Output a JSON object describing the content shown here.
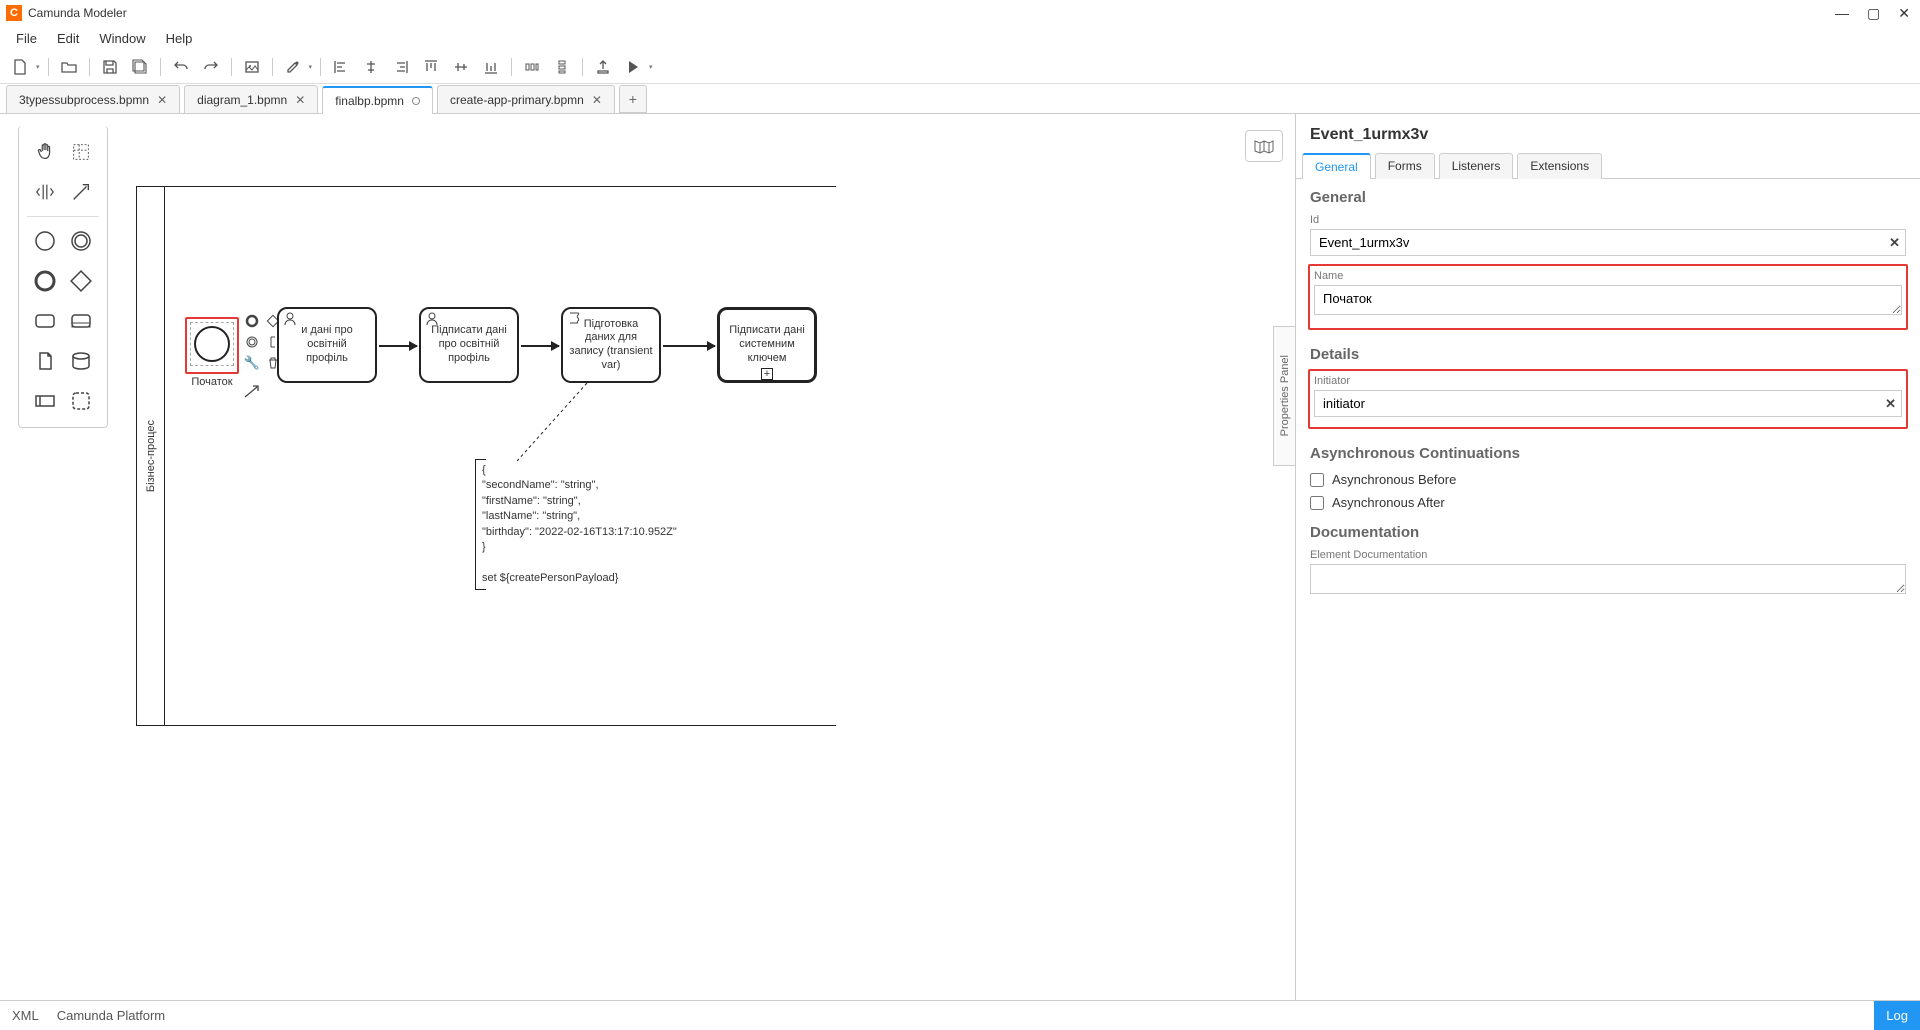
{
  "titlebar": {
    "title": "Camunda Modeler"
  },
  "menubar": {
    "file": "File",
    "edit": "Edit",
    "window": "Window",
    "help": "Help"
  },
  "tabs": [
    {
      "label": "3typessubprocess.bpmn",
      "active": false,
      "dirty": false
    },
    {
      "label": "diagram_1.bpmn",
      "active": false,
      "dirty": false
    },
    {
      "label": "finalbp.bpmn",
      "active": true,
      "dirty": true
    },
    {
      "label": "create-app-primary.bpmn",
      "active": false,
      "dirty": false
    }
  ],
  "canvas": {
    "propertiesPanelToggle": "Properties Panel",
    "poolLabel": "Бізнес-процес",
    "startEventLabel": "Початок",
    "task1": "и дані про освітній профіль",
    "task2": "Підписати дані про освітній профіль",
    "task3": "Підготовка даних для запису (transient var)",
    "task4": "Підписати дані системним ключем",
    "annotation": "{\n  \"secondName\": \"string\",\n  \"firstName\": \"string\",\n  \"lastName\": \"string\",\n  \"birthday\": \"2022-02-16T13:17:10.952Z\"\n}\n\nset ${createPersonPayload}"
  },
  "props": {
    "header": "Event_1urmx3v",
    "tabs": {
      "general": "General",
      "forms": "Forms",
      "listeners": "Listeners",
      "extensions": "Extensions"
    },
    "groupGeneral": "General",
    "idLabel": "Id",
    "idValue": "Event_1urmx3v",
    "nameLabel": "Name",
    "nameValue": "Початок",
    "groupDetails": "Details",
    "initiatorLabel": "Initiator",
    "initiatorValue": "initiator",
    "groupAsync": "Asynchronous Continuations",
    "asyncBefore": "Asynchronous Before",
    "asyncAfter": "Asynchronous After",
    "groupDoc": "Documentation",
    "docLabel": "Element Documentation"
  },
  "statusbar": {
    "xml": "XML",
    "platform": "Camunda Platform",
    "log": "Log"
  }
}
